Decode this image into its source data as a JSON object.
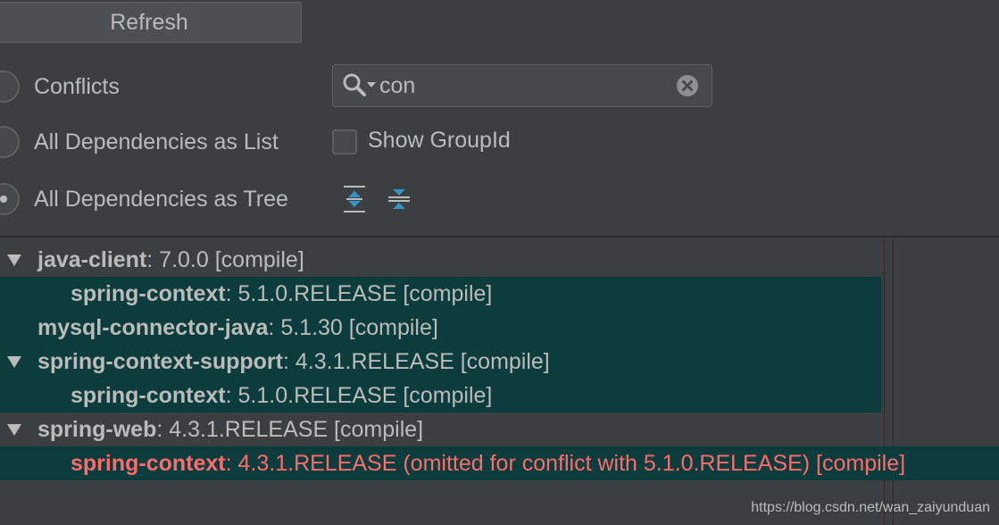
{
  "toolbar": {
    "refresh_label": "Refresh"
  },
  "view_modes": {
    "conflicts_label": "Conflicts",
    "list_label": "All Dependencies as List",
    "tree_label": "All Dependencies as Tree",
    "selected": "tree"
  },
  "search": {
    "value": "con",
    "icon": "search-icon",
    "clear_icon": "clear-icon"
  },
  "options": {
    "show_groupid_label": "Show GroupId",
    "show_groupid_checked": false
  },
  "tree_tools": {
    "expand_icon": "expand-all-icon",
    "collapse_icon": "collapse-all-icon"
  },
  "tree": {
    "rows": [
      {
        "name": "java-client",
        "detail": " : 7.0.0 [compile]",
        "level": 0,
        "expanded": true,
        "highlighted": false,
        "conflict": false
      },
      {
        "name": "spring-context",
        "detail": " : 5.1.0.RELEASE [compile]",
        "level": 1,
        "expanded": null,
        "highlighted": true,
        "conflict": false
      },
      {
        "name": "mysql-connector-java",
        "detail": " : 5.1.30 [compile]",
        "level": 0,
        "expanded": null,
        "highlighted": false,
        "conflict": false
      },
      {
        "name": "spring-context-support",
        "detail": " : 4.3.1.RELEASE [compile]",
        "level": 0,
        "expanded": true,
        "highlighted": true,
        "conflict": false
      },
      {
        "name": "spring-context",
        "detail": " : 5.1.0.RELEASE [compile]",
        "level": 1,
        "expanded": null,
        "highlighted": true,
        "conflict": false
      },
      {
        "name": "spring-web",
        "detail": " : 4.3.1.RELEASE [compile]",
        "level": 0,
        "expanded": true,
        "highlighted": false,
        "conflict": false
      },
      {
        "name": "spring-context",
        "detail": " : 4.3.1.RELEASE (omitted for conflict with 5.1.0.RELEASE) [compile]",
        "level": 1,
        "expanded": null,
        "highlighted": true,
        "conflict": true
      }
    ]
  },
  "watermark": "https://blog.csdn.net/wan_zaiyunduan",
  "colors": {
    "background": "#3c3f41",
    "highlight_row": "#0c3c3c",
    "conflict_text": "#ff6b6b",
    "text": "#bbbbbb",
    "icon_blue": "#3592c4"
  }
}
